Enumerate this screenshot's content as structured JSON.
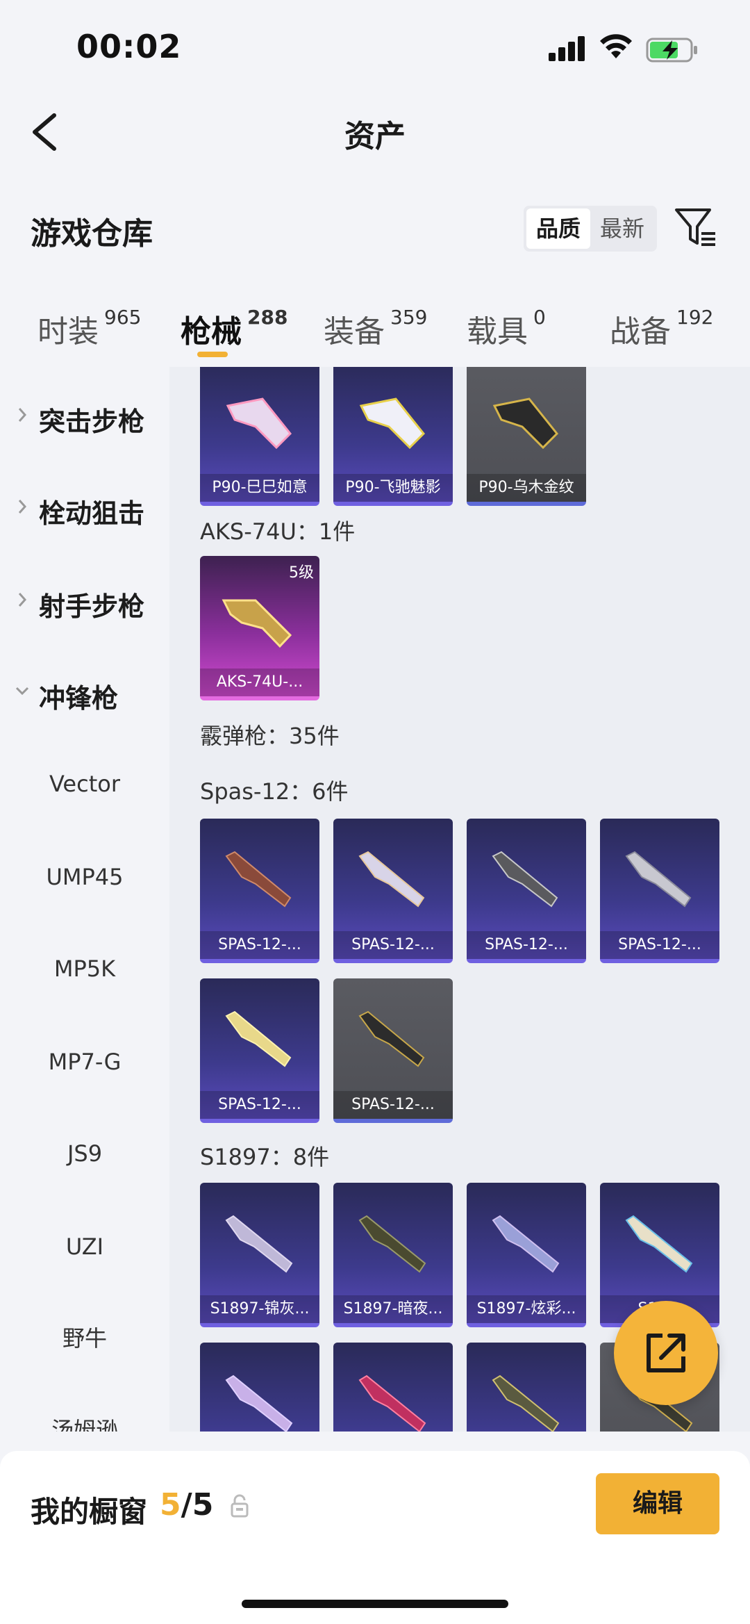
{
  "status_bar": {
    "time": "00:02"
  },
  "header": {
    "title": "资产"
  },
  "warehouse": {
    "title": "游戏仓库",
    "sort_options": [
      "品质",
      "最新"
    ],
    "sort_selected": "品质"
  },
  "tabs": [
    {
      "label": "时装",
      "count": "965"
    },
    {
      "label": "枪械",
      "count": "288"
    },
    {
      "label": "装备",
      "count": "359"
    },
    {
      "label": "载具",
      "count": "0"
    },
    {
      "label": "战备",
      "count": "192"
    }
  ],
  "active_tab": "枪械",
  "sidebar": {
    "categories": [
      {
        "label": "突击步枪",
        "expanded": false
      },
      {
        "label": "栓动狙击",
        "expanded": false
      },
      {
        "label": "射手步枪",
        "expanded": false
      },
      {
        "label": "冲锋枪",
        "expanded": true
      }
    ],
    "subitems": [
      "Vector",
      "UMP45",
      "MP5K",
      "MP7-G",
      "JS9",
      "UZI",
      "野牛",
      "汤姆逊"
    ]
  },
  "content": {
    "p90_cards": [
      "P90-巳巳如意",
      "P90-飞驰魅影",
      "P90-乌木金纹"
    ],
    "aks_label": "AKS-74U：1件",
    "aks_cards": [
      {
        "name": "AKS-74U-...",
        "level": "5级"
      }
    ],
    "shotgun_label": "霰弹枪：35件",
    "spas_label": "Spas-12：6件",
    "spas_cards": [
      "SPAS-12-...",
      "SPAS-12-...",
      "SPAS-12-...",
      "SPAS-12-...",
      "SPAS-12-...",
      "SPAS-12-..."
    ],
    "s1897_label": "S1897：8件",
    "s1897_cards": [
      "S1897-锦灰...",
      "S1897-暗夜...",
      "S1897-炫彩...",
      "S18..."
    ]
  },
  "bottom_bar": {
    "showcase_label": "我的橱窗",
    "showcase_current": "5",
    "showcase_total": "/5",
    "edit_label": "编辑"
  },
  "colors": {
    "accent": "#f2b135",
    "card_purple": "#3d3a8c",
    "card_gray": "#4e4f55",
    "card_pink": "#d04ad0"
  }
}
